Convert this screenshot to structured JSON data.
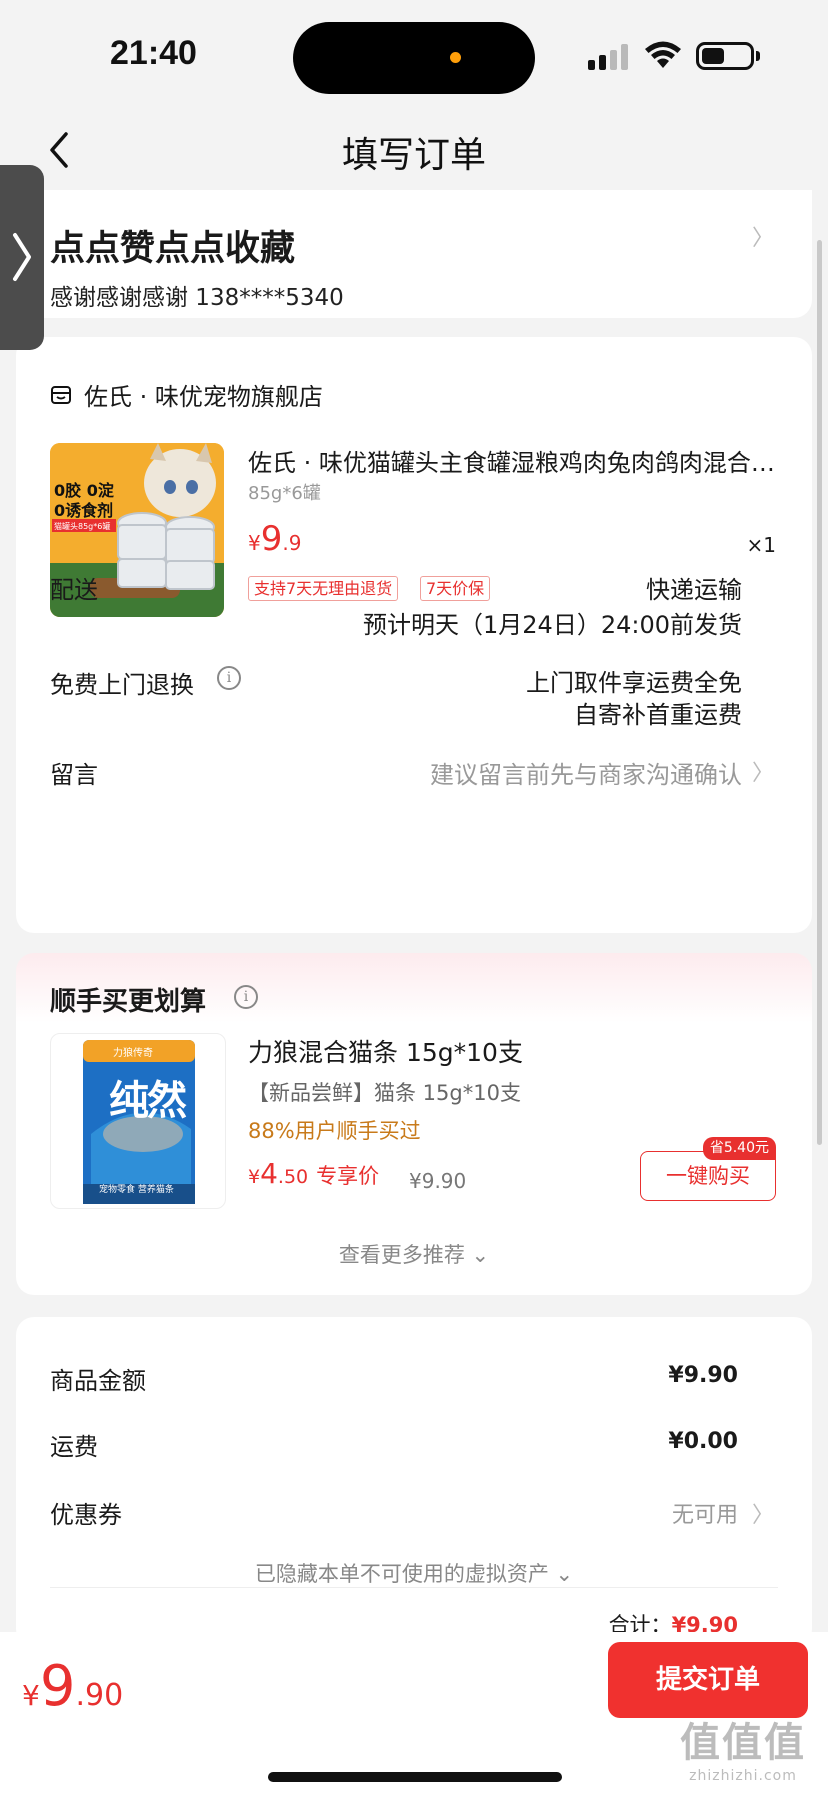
{
  "status": {
    "time": "21:40"
  },
  "nav": {
    "title": "填写订单",
    "back_icon": "chevron-left-icon"
  },
  "address": {
    "name": "点点赞点点收藏",
    "contact": "感谢感谢感谢  138****5340"
  },
  "order": {
    "shop_name": "佐氏 · 味优宠物旗舰店",
    "product": {
      "title": "佐氏 · 味优猫罐头主食罐湿粮鸡肉兔肉鸽肉混合口味",
      "spec": "85g*6罐",
      "price_currency": "¥",
      "price_int": "9",
      "price_dec": ".9",
      "qty": "×1",
      "tags": [
        "支持7天无理由退货",
        "7天价保"
      ],
      "image_text": {
        "line1": "0胶 0淀",
        "line2": "0诱食剂",
        "line3": "猫罐头85g*6罐"
      }
    },
    "delivery": {
      "label": "配送",
      "method": "快递运输",
      "eta": "预计明天（1月24日）24:00前发货"
    },
    "return": {
      "label": "免费上门退换",
      "line1": "上门取件享运费全免",
      "line2": "自寄补首重运费"
    },
    "message": {
      "label": "留言",
      "placeholder": "建议留言前先与商家沟通确认"
    }
  },
  "recommend": {
    "title": "顺手买更划算",
    "item": {
      "name": "力狼混合猫条 15g*10支",
      "subtitle": "【新品尝鲜】猫条 15g*10支",
      "users": "88%用户顺手买过",
      "price_currency": "¥",
      "price_int": "4",
      "price_dec": ".50",
      "price_label": "专享价",
      "original_price": "¥9.90",
      "save_badge": "省5.40元",
      "buy_label": "一键购买",
      "image_text": {
        "brand": "力狼传奇",
        "big": "纯然",
        "sub": "宠物零食 营养猫条"
      }
    },
    "more": "查看更多推荐"
  },
  "summary": {
    "goods_label": "商品金额",
    "goods_value": "¥9.90",
    "shipping_label": "运费",
    "shipping_value": "¥0.00",
    "coupon_label": "优惠券",
    "coupon_value": "无可用",
    "hidden_note": "已隐藏本单不可使用的虚拟资产",
    "total_label": "合计：",
    "total_value": "¥9.90"
  },
  "bottom": {
    "price_currency": "¥",
    "price_int": "9",
    "price_dec": ".90",
    "submit": "提交订单"
  },
  "watermark": {
    "big": "值值值",
    "small": "zhizhizhi.com"
  },
  "colors": {
    "accent": "#e8302f",
    "background": "#f3f3f3",
    "card": "#ffffff"
  }
}
